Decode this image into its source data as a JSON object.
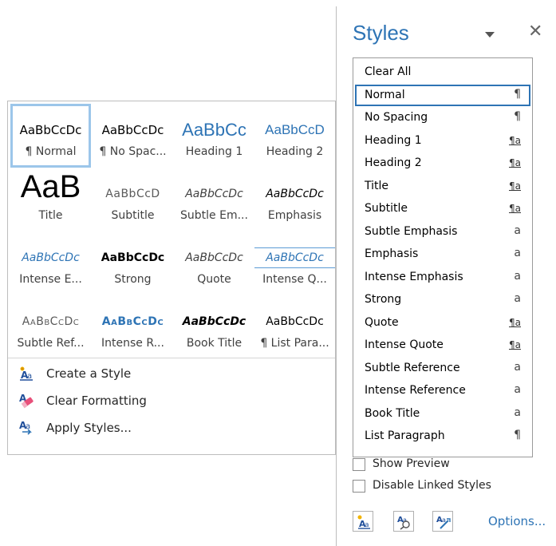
{
  "gallery": {
    "tiles": [
      {
        "preview": "AaBbCcDc",
        "name": "¶ Normal"
      },
      {
        "preview": "AaBbCcDc",
        "name": "¶ No Spac..."
      },
      {
        "preview": "AaBbCc",
        "name": "Heading 1"
      },
      {
        "preview": "AaBbCcD",
        "name": "Heading 2"
      },
      {
        "preview": "AaB",
        "name": "Title"
      },
      {
        "preview": "AaBbCcD",
        "name": "Subtitle"
      },
      {
        "preview": "AaBbCcDc",
        "name": "Subtle Em..."
      },
      {
        "preview": "AaBbCcDc",
        "name": "Emphasis"
      },
      {
        "preview": "AaBbCcDc",
        "name": "Intense E..."
      },
      {
        "preview": "AaBbCcDc",
        "name": "Strong"
      },
      {
        "preview": "AaBbCcDc",
        "name": "Quote"
      },
      {
        "preview": "AaBbCcDc",
        "name": "Intense Q..."
      },
      {
        "preview": "AaBbCcDc",
        "name": "Subtle Ref..."
      },
      {
        "preview": "AaBbCcDc",
        "name": "Intense R..."
      },
      {
        "preview": "AaBbCcDc",
        "name": "Book Title"
      },
      {
        "preview": "AaBbCcDc",
        "name": "¶ List Para..."
      }
    ],
    "menu": [
      {
        "label": "Create a Style",
        "icon": "create-style-icon"
      },
      {
        "label": "Clear Formatting",
        "icon": "clear-formatting-icon"
      },
      {
        "label": "Apply Styles...",
        "icon": "apply-styles-icon"
      }
    ]
  },
  "pane": {
    "title": "Styles",
    "close": "✕",
    "styles": [
      {
        "name": "Clear All",
        "symbol": ""
      },
      {
        "name": "Normal",
        "symbol": "¶"
      },
      {
        "name": "No Spacing",
        "symbol": "¶"
      },
      {
        "name": "Heading 1",
        "symbol": "¶a"
      },
      {
        "name": "Heading 2",
        "symbol": "¶a"
      },
      {
        "name": "Title",
        "symbol": "¶a"
      },
      {
        "name": "Subtitle",
        "symbol": "¶a"
      },
      {
        "name": "Subtle Emphasis",
        "symbol": "a"
      },
      {
        "name": "Emphasis",
        "symbol": "a"
      },
      {
        "name": "Intense Emphasis",
        "symbol": "a"
      },
      {
        "name": "Strong",
        "symbol": "a"
      },
      {
        "name": "Quote",
        "symbol": "¶a"
      },
      {
        "name": "Intense Quote",
        "symbol": "¶a"
      },
      {
        "name": "Subtle Reference",
        "symbol": "a"
      },
      {
        "name": "Intense Reference",
        "symbol": "a"
      },
      {
        "name": "Book Title",
        "symbol": "a"
      },
      {
        "name": "List Paragraph",
        "symbol": "¶"
      }
    ],
    "selected_style": "Normal",
    "show_preview": "Show Preview",
    "disable_linked": "Disable Linked Styles",
    "options": "Options...",
    "buttons": [
      "new-style-icon",
      "style-inspector-icon",
      "manage-styles-icon"
    ],
    "colors": {
      "accent": "#2e74b5",
      "selection": "#9cc6ea"
    }
  }
}
